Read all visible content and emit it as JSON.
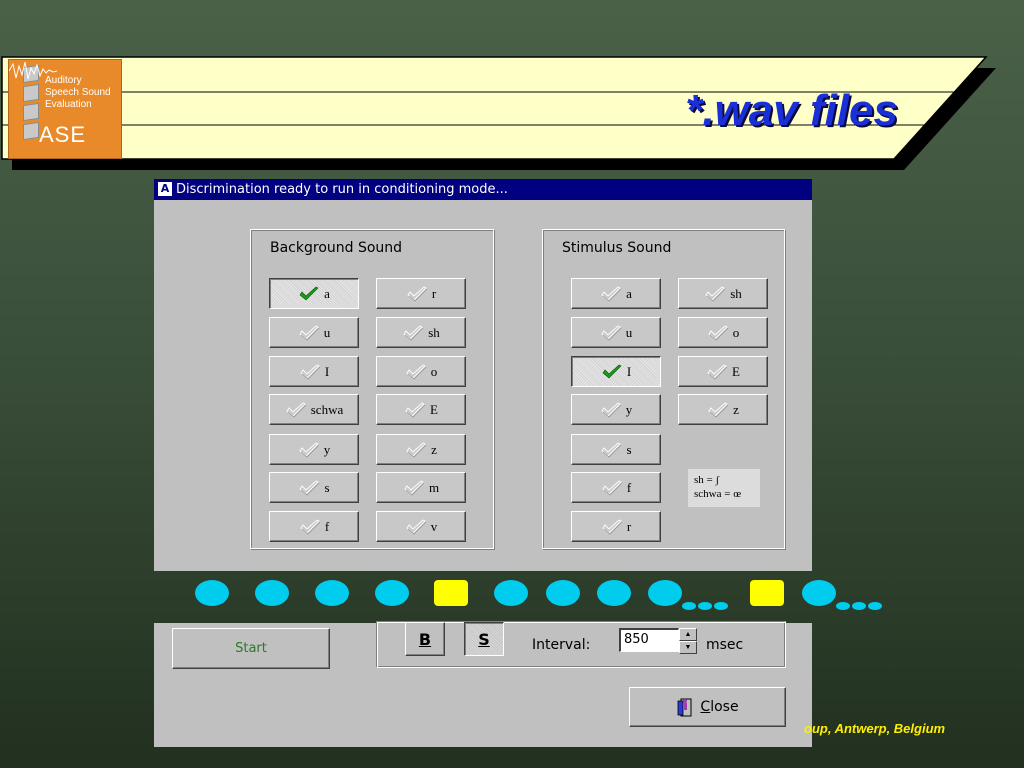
{
  "banner": {
    "title": "*.wav files",
    "logo": {
      "lines": [
        "Auditory",
        "Speech Sound",
        "Evaluation"
      ],
      "abbr": "ASE"
    }
  },
  "dialog": {
    "title": "Discrimination ready to run in conditioning mode...",
    "background_group": {
      "title": "Background Sound",
      "sounds": [
        {
          "label": "a",
          "selected": true
        },
        {
          "label": "r",
          "selected": false
        },
        {
          "label": "u",
          "selected": false
        },
        {
          "label": "sh",
          "selected": false
        },
        {
          "label": "I",
          "selected": false
        },
        {
          "label": "o",
          "selected": false
        },
        {
          "label": "schwa",
          "selected": false
        },
        {
          "label": "E",
          "selected": false
        },
        {
          "label": "y",
          "selected": false
        },
        {
          "label": "z",
          "selected": false
        },
        {
          "label": "s",
          "selected": false
        },
        {
          "label": "m",
          "selected": false
        },
        {
          "label": "f",
          "selected": false
        },
        {
          "label": "v",
          "selected": false
        }
      ]
    },
    "stimulus_group": {
      "title": "Stimulus Sound",
      "sounds": [
        {
          "label": "a",
          "selected": false
        },
        {
          "label": "sh",
          "selected": false
        },
        {
          "label": "u",
          "selected": false
        },
        {
          "label": "o",
          "selected": false
        },
        {
          "label": "I",
          "selected": true
        },
        {
          "label": "E",
          "selected": false
        },
        {
          "label": "y",
          "selected": false
        },
        {
          "label": "z",
          "selected": false
        },
        {
          "label": "s",
          "selected": false
        },
        {
          "label": "f",
          "selected": false
        },
        {
          "label": "r",
          "selected": false
        }
      ],
      "note_line1": "sh = ʃ",
      "note_line2": "schwa = œ"
    }
  },
  "sequence": {
    "items": [
      "dot",
      "dot",
      "dot",
      "dot",
      "square",
      "dot",
      "dot",
      "dot",
      "dot-ellipsis",
      "square",
      "dot-ellipsis"
    ],
    "colors": {
      "dot": "#00ccee",
      "square": "#ffff00"
    }
  },
  "controls": {
    "start_label": "Start",
    "b_label": "B",
    "s_label": "S",
    "s_pressed": true,
    "interval_label": "Interval:",
    "interval_value": "850",
    "interval_unit": "msec",
    "close_label": "Close"
  },
  "footer": {
    "text": "oup, Antwerp, Belgium"
  },
  "colors": {
    "title_blue": "#1a2fd6",
    "banner_fill": "#ffffc8",
    "logo_orange": "#e88a2a",
    "titlebar": "#000080",
    "footer_yellow": "#ffee00",
    "check_green": "#1a9a1a"
  }
}
